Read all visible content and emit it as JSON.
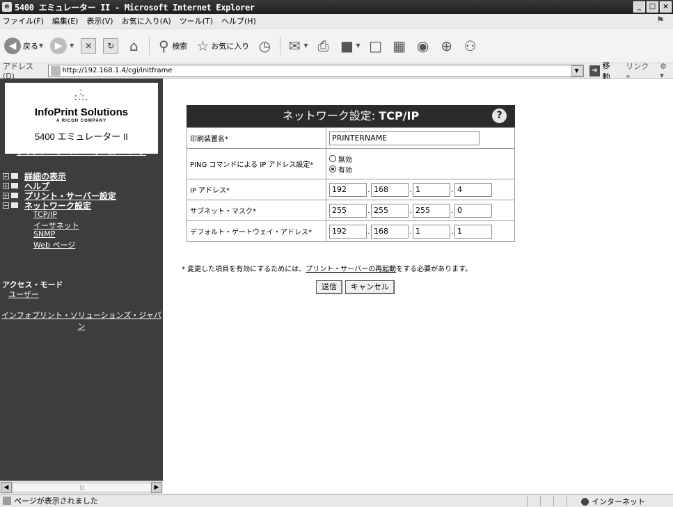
{
  "window": {
    "title": "5400 エミュレーター II - Microsoft Internet Explorer",
    "app_icon": "ie-icon",
    "controls": [
      "_",
      "□",
      "×"
    ]
  },
  "menubar": {
    "items": [
      "ファイル(F)",
      "編集(E)",
      "表示(V)",
      "お気に入り(A)",
      "ツール(T)",
      "ヘルプ(H)"
    ]
  },
  "toolbar": {
    "back_label": "戻る",
    "search_label": "検索",
    "favorites_label": "お気に入り"
  },
  "addressbar": {
    "label": "アドレス(D)",
    "url": "http://192.168.1.4/cgi/initframe",
    "go_label": "移動",
    "links_label": "リンク",
    "chevron": "»"
  },
  "sidebar": {
    "logo_name": "InfoPrint Solutions",
    "logo_sub": "A RICOH COMPANY",
    "product_name": "5400 エミュレーター II",
    "home_link": "プリント・サーバー・ホーム・ページ",
    "tree": [
      {
        "toggle": "+",
        "label": "詳細の表示"
      },
      {
        "toggle": "+",
        "label": "ヘルプ"
      },
      {
        "toggle": "+",
        "label": "プリント・サーバー設定"
      },
      {
        "toggle": "−",
        "label": "ネットワーク設定"
      }
    ],
    "network_children": [
      "TCP/IP",
      "イーサネット",
      "SNMP",
      "Web ページ"
    ],
    "access_heading": "アクセス・モード",
    "access_user": "ユーザー",
    "japan_link": "インフォプリント・ソリューションズ・ジャパン"
  },
  "panel": {
    "title_prefix": "ネットワーク設定: ",
    "title_protocol": "TCP/IP",
    "help_glyph": "?",
    "device_name_label": "印刷装置名*",
    "device_name_value": "PRINTERNAME",
    "ping_label": "PING コマンドによる IP アドレス設定*",
    "ping_options": [
      {
        "label": "無効",
        "checked": false
      },
      {
        "label": "有効",
        "checked": true
      }
    ],
    "ip_label": "IP アドレス*",
    "ip": [
      "192",
      "168",
      "1",
      "4"
    ],
    "subnet_label": "サブネット・マスク*",
    "subnet": [
      "255",
      "255",
      "255",
      "0"
    ],
    "gateway_label": "デフォルト・ゲートウェイ・アドレス*",
    "gateway": [
      "192",
      "168",
      "1",
      "1"
    ]
  },
  "note": {
    "prefix": "* 変更した項目を有効にするためには、",
    "link": "プリント・サーバーの再起動",
    "suffix": "をする必要があります。"
  },
  "buttons": {
    "submit": "送信",
    "cancel": "キャンセル"
  },
  "statusbar": {
    "text": "ページが表示されました",
    "zone": "インターネット"
  }
}
